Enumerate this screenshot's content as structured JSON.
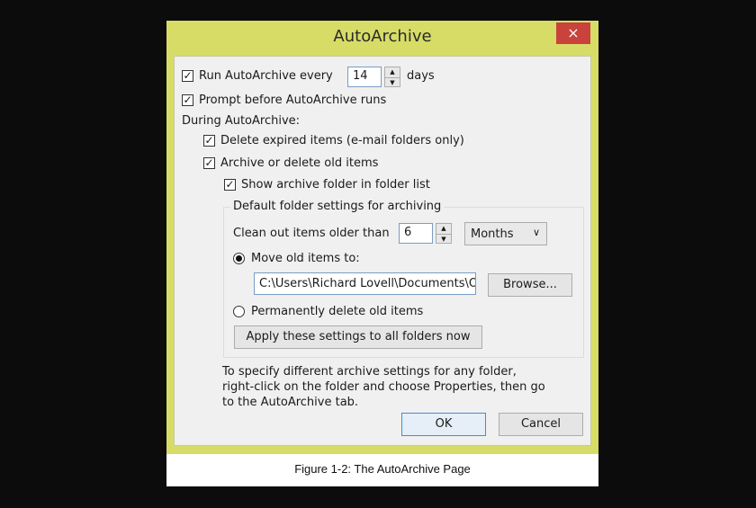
{
  "dialog": {
    "title": "AutoArchive",
    "close_icon": "×",
    "run_every": {
      "label": "Run AutoArchive every",
      "checked": true,
      "value": "14",
      "unit": "days"
    },
    "prompt": {
      "label": "Prompt before AutoArchive runs",
      "checked": true
    },
    "during_label": "During AutoArchive:",
    "delete_expired": {
      "label": "Delete expired items (e-mail folders only)",
      "checked": true
    },
    "archive_old": {
      "label": "Archive or delete old items",
      "checked": true
    },
    "show_folder": {
      "label": "Show archive folder in folder list",
      "checked": true
    },
    "group_title": "Default folder settings for archiving",
    "clean_out": {
      "label": "Clean out items older than",
      "value": "6",
      "unit_selected": "Months"
    },
    "move_old": {
      "label": "Move old items to:",
      "selected": true,
      "path": "C:\\Users\\Richard Lovell\\Documents\\O"
    },
    "browse_label": "Browse...",
    "permanently_delete": {
      "label": "Permanently delete old items",
      "selected": false
    },
    "apply_label": "Apply these settings to all folders now",
    "help_lines": [
      "To specify different archive settings for any folder,",
      "right-click on the folder and choose Properties, then go",
      "to the AutoArchive tab."
    ],
    "ok_label": "OK",
    "cancel_label": "Cancel",
    "check_glyph": "✓"
  },
  "caption": "Figure 1-2: The AutoArchive Page",
  "colors": {
    "frame": "#d7dc66",
    "close": "#c9423c",
    "panel": "#f0f0f0"
  }
}
